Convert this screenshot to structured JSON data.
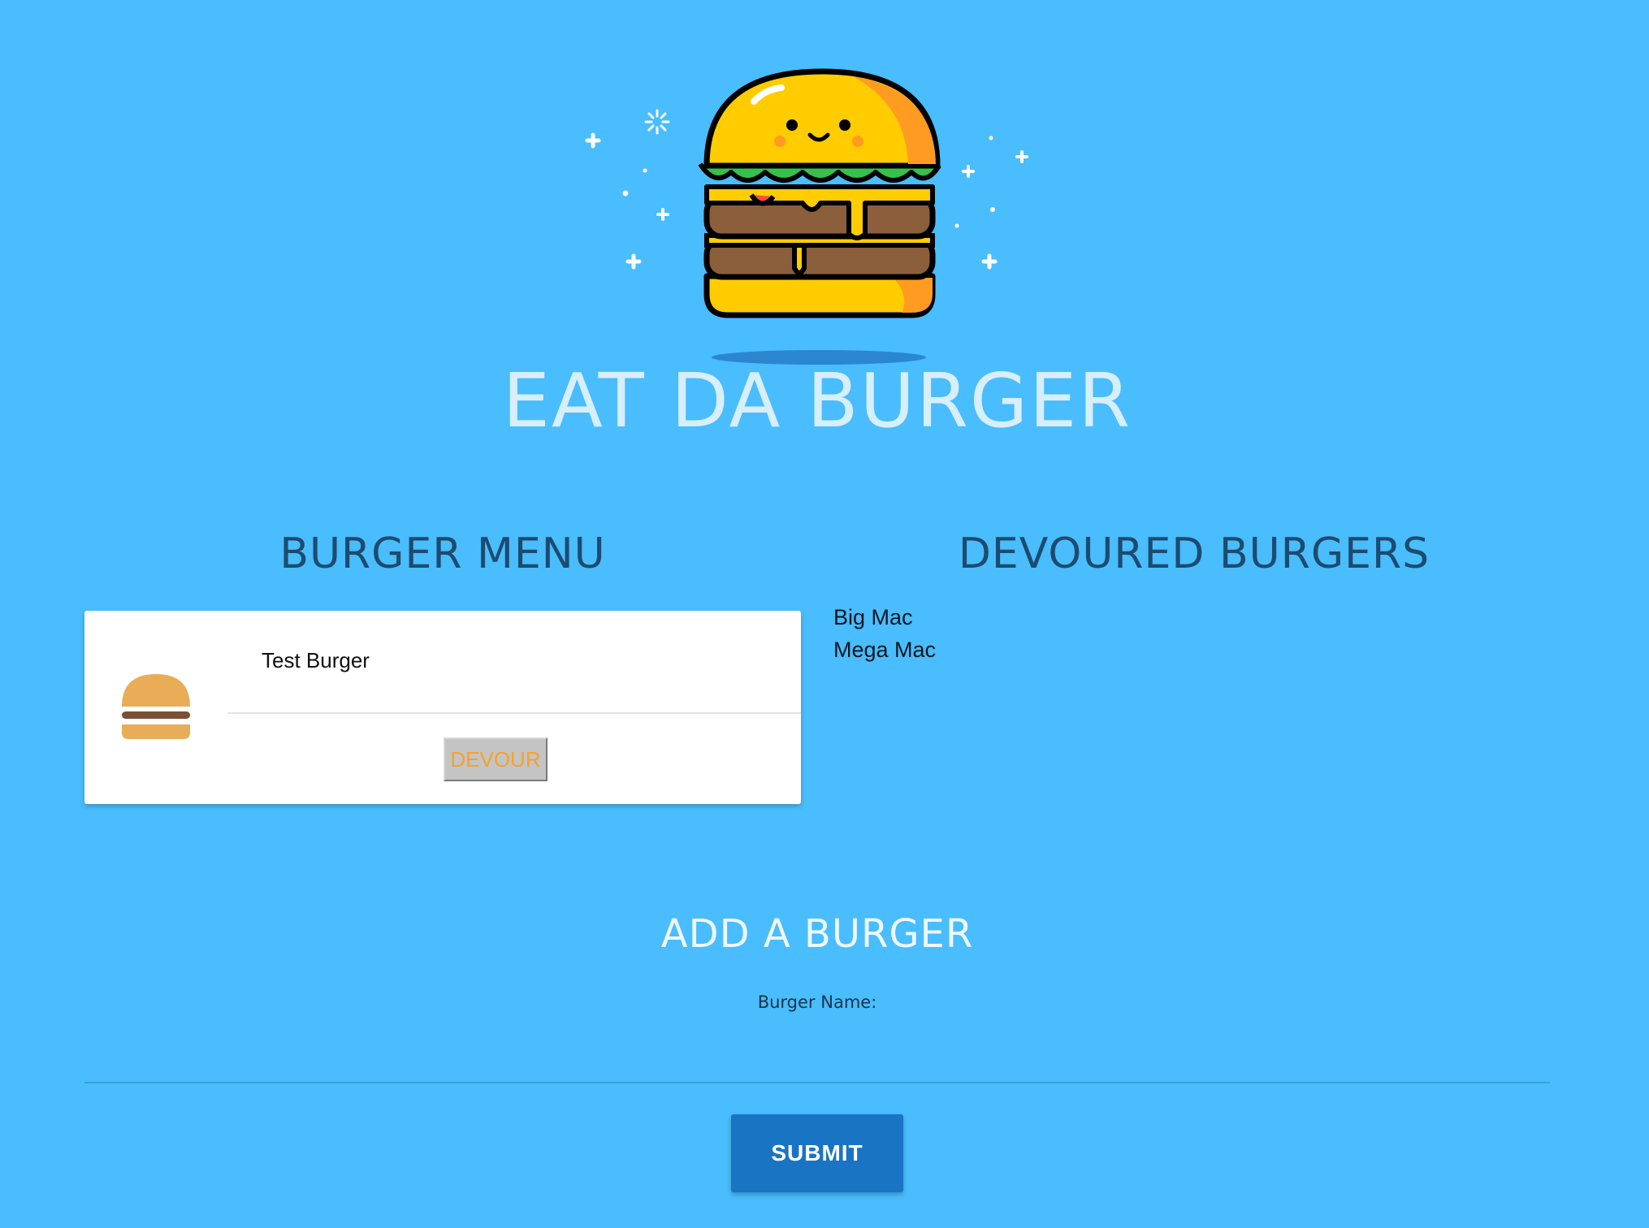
{
  "header": {
    "title": "EAT DA BURGER",
    "logo_icon": "smiling-burger-icon"
  },
  "menu": {
    "heading": "BURGER MENU",
    "items": [
      {
        "name": "Test Burger",
        "icon": "burger-icon",
        "button_label": "DEVOUR"
      }
    ]
  },
  "devoured": {
    "heading": "DEVOURED BURGERS",
    "items": [
      "Big Mac",
      "Mega Mac"
    ]
  },
  "add_form": {
    "heading": "ADD A BURGER",
    "label": "Burger Name:",
    "input_value": "",
    "submit_label": "SUBMIT"
  },
  "colors": {
    "background": "#49bdfd",
    "submit_button": "#1a74c4",
    "devour_text": "#f7a12a",
    "heading_dark": "#1d4b6f"
  }
}
